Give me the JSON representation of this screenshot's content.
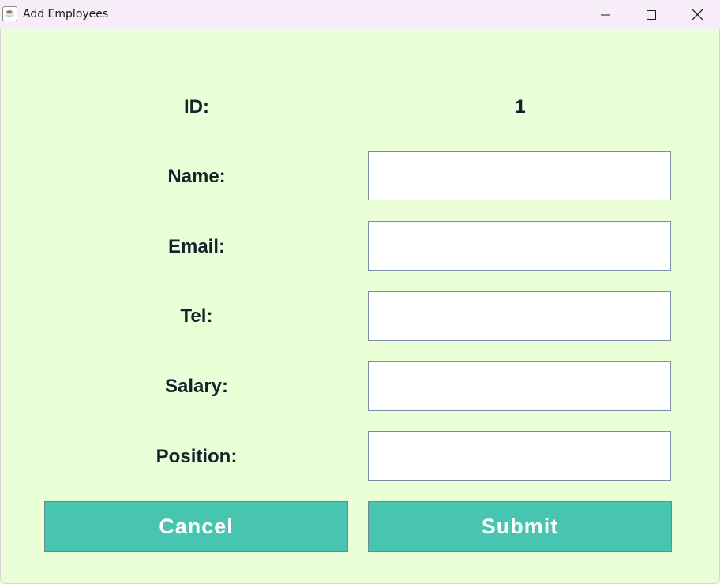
{
  "window": {
    "title": "Add Employees",
    "app_icon": "java-cup-icon",
    "controls": [
      "minimize-icon",
      "maximize-icon",
      "close-icon"
    ]
  },
  "form": {
    "id_label": "ID:",
    "id_value": "1",
    "fields": [
      {
        "label": "Name:",
        "value": "",
        "placeholder": ""
      },
      {
        "label": "Email:",
        "value": "",
        "placeholder": ""
      },
      {
        "label": "Tel:",
        "value": "",
        "placeholder": ""
      },
      {
        "label": "Salary:",
        "value": "",
        "placeholder": ""
      },
      {
        "label": "Position:",
        "value": "",
        "placeholder": ""
      }
    ]
  },
  "buttons": {
    "cancel_label": "Cancel",
    "submit_label": "Submit"
  },
  "colors": {
    "background": "#eaffd8",
    "titlebar": "#f6edf8",
    "button": "#47c5b0",
    "label_text": "#12232b"
  }
}
